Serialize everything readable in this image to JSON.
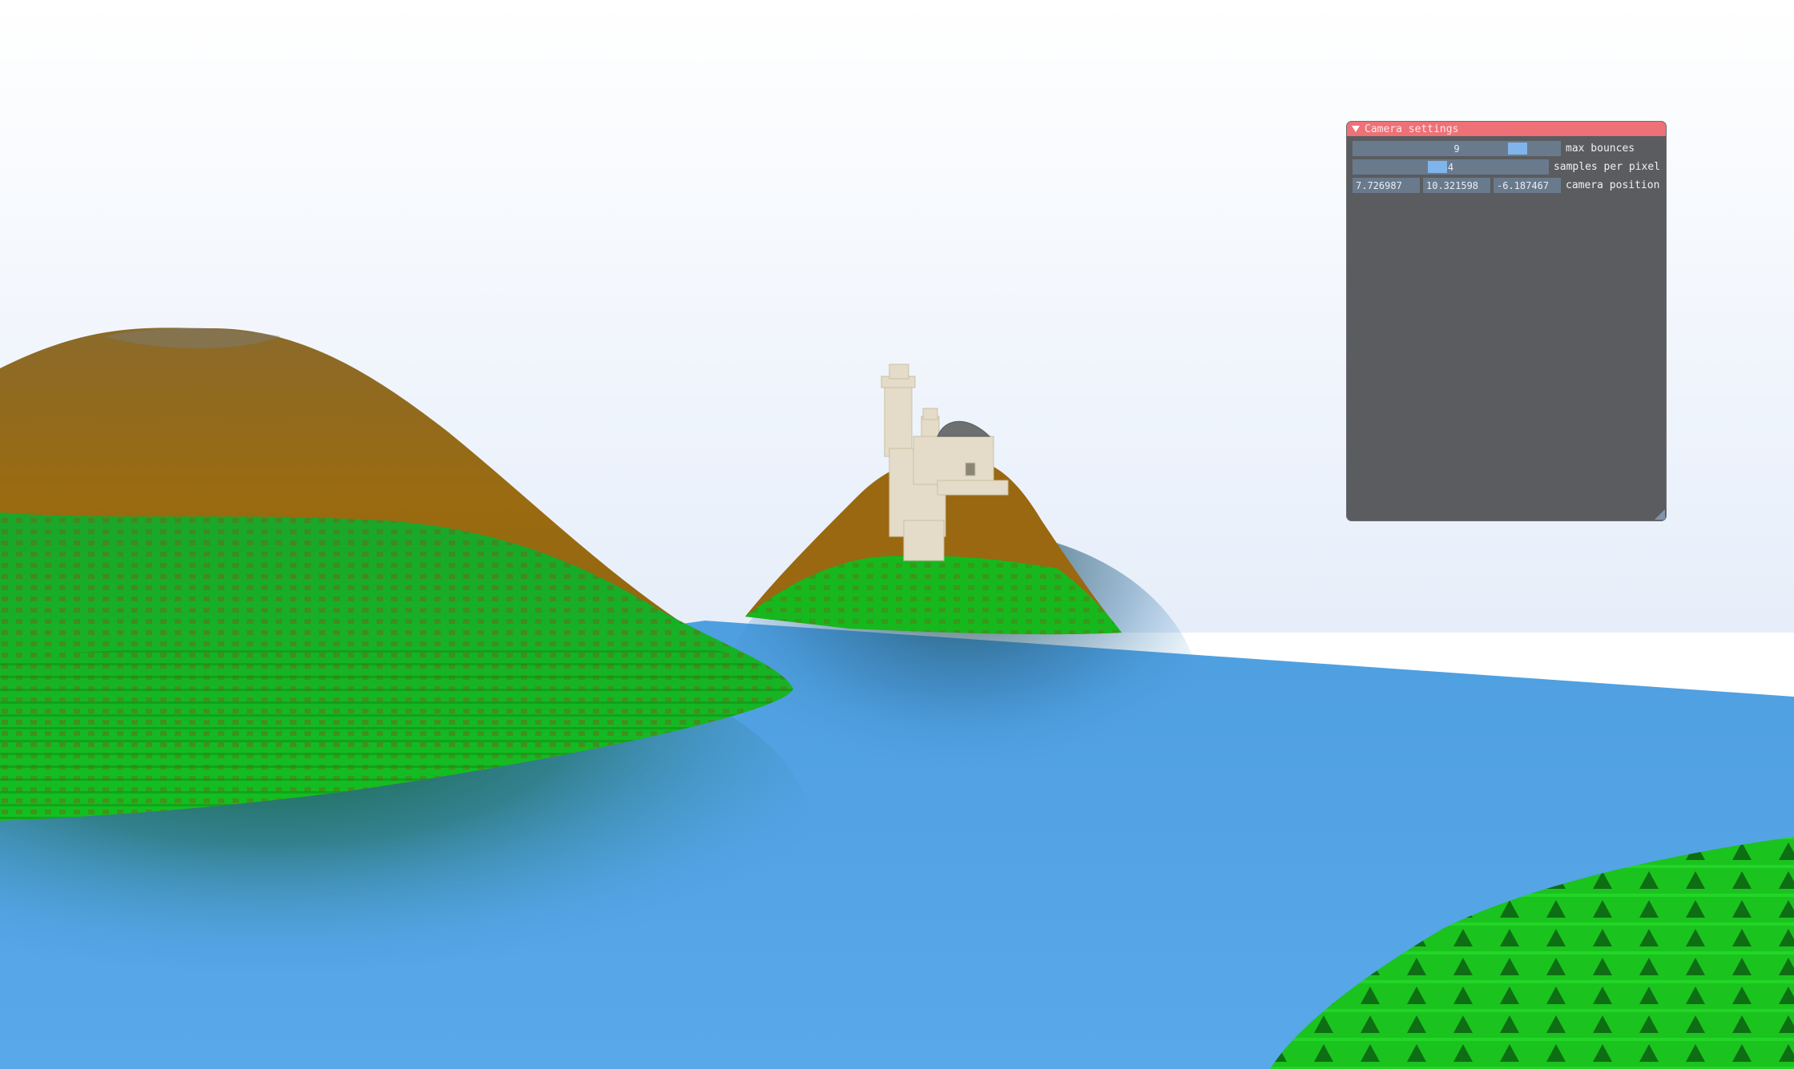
{
  "window": {
    "title": "Camera settings",
    "rows": {
      "max_bounces": {
        "label": "max bounces",
        "value": "9",
        "fraction": 0.82
      },
      "samples_per_pixel": {
        "label": "samples per pixel",
        "value": "4",
        "fraction": 0.4
      },
      "camera_position": {
        "label": "camera position",
        "values": [
          "7.726987",
          "10.321598",
          "-6.187467"
        ]
      }
    }
  },
  "icons": {
    "collapse": "triangle-down-icon",
    "resize": "resize-grip-icon"
  },
  "colors": {
    "sky_top": "#e7eef9",
    "sky_bottom": "#f6f8fc",
    "water": "#56a6e7",
    "grass": "#17c41c",
    "dirt": "#96690e",
    "title_bar": "#ee7178",
    "window_bg": "#5a5c5f",
    "frame_bg": "#6a7a8d",
    "slider_grab": "#7fb5ea"
  }
}
